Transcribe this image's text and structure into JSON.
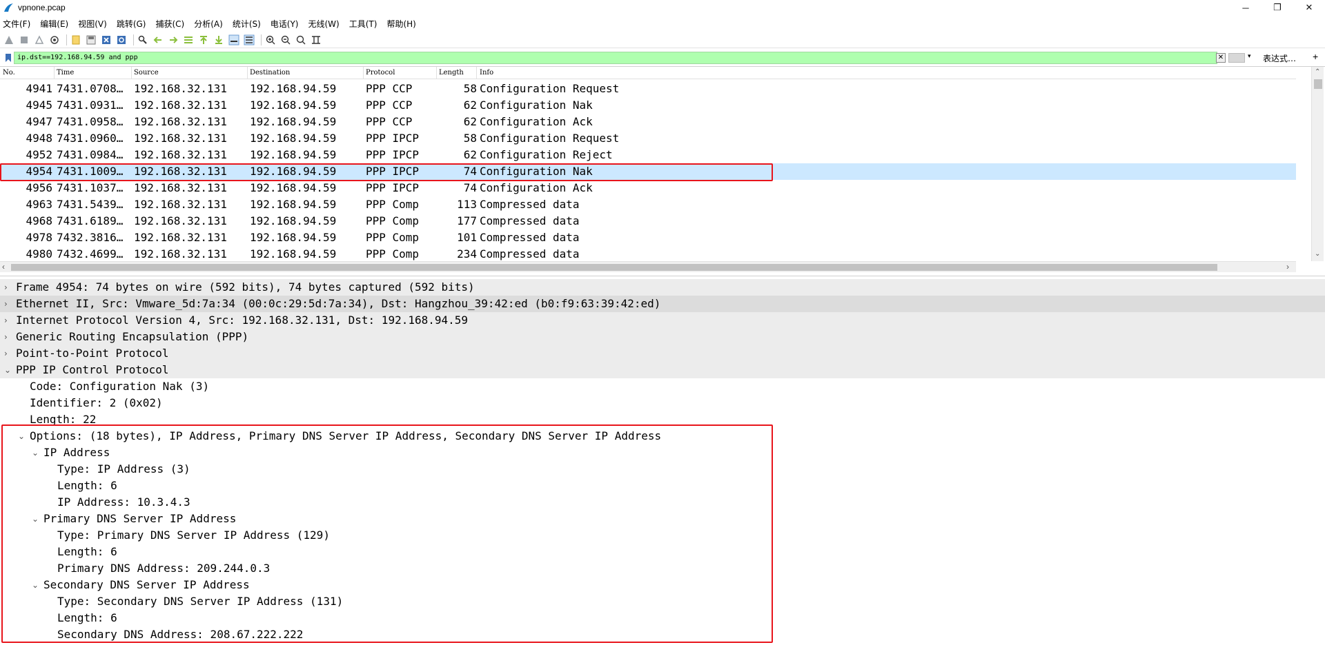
{
  "window": {
    "title": "vpnone.pcap",
    "minimize": "─",
    "restore": "❐",
    "close": "✕"
  },
  "menu": [
    "文件(F)",
    "编辑(E)",
    "视图(V)",
    "跳转(G)",
    "捕获(C)",
    "分析(A)",
    "统计(S)",
    "电话(Y)",
    "无线(W)",
    "工具(T)",
    "帮助(H)"
  ],
  "filter": {
    "value": "ip.dst==192.168.94.59 and ppp",
    "clear": "✕",
    "dropdown": "▾",
    "expression_label": "表达式…",
    "plus": "+"
  },
  "packet_list": {
    "columns": [
      "No.",
      "Time",
      "Source",
      "Destination",
      "Protocol",
      "Length",
      "Info"
    ],
    "rows": [
      {
        "no": "4941",
        "time": "7431.0708…",
        "src": "192.168.32.131",
        "dst": "192.168.94.59",
        "proto": "PPP CCP",
        "len": "58",
        "info": "Configuration Request"
      },
      {
        "no": "4945",
        "time": "7431.0931…",
        "src": "192.168.32.131",
        "dst": "192.168.94.59",
        "proto": "PPP CCP",
        "len": "62",
        "info": "Configuration Nak"
      },
      {
        "no": "4947",
        "time": "7431.0958…",
        "src": "192.168.32.131",
        "dst": "192.168.94.59",
        "proto": "PPP CCP",
        "len": "62",
        "info": "Configuration Ack"
      },
      {
        "no": "4948",
        "time": "7431.0960…",
        "src": "192.168.32.131",
        "dst": "192.168.94.59",
        "proto": "PPP IPCP",
        "len": "58",
        "info": "Configuration Request"
      },
      {
        "no": "4952",
        "time": "7431.0984…",
        "src": "192.168.32.131",
        "dst": "192.168.94.59",
        "proto": "PPP IPCP",
        "len": "62",
        "info": "Configuration Reject"
      },
      {
        "no": "4954",
        "time": "7431.1009…",
        "src": "192.168.32.131",
        "dst": "192.168.94.59",
        "proto": "PPP IPCP",
        "len": "74",
        "info": "Configuration Nak",
        "selected": true
      },
      {
        "no": "4956",
        "time": "7431.1037…",
        "src": "192.168.32.131",
        "dst": "192.168.94.59",
        "proto": "PPP IPCP",
        "len": "74",
        "info": "Configuration Ack"
      },
      {
        "no": "4963",
        "time": "7431.5439…",
        "src": "192.168.32.131",
        "dst": "192.168.94.59",
        "proto": "PPP Comp",
        "len": "113",
        "info": "Compressed data"
      },
      {
        "no": "4968",
        "time": "7431.6189…",
        "src": "192.168.32.131",
        "dst": "192.168.94.59",
        "proto": "PPP Comp",
        "len": "177",
        "info": "Compressed data"
      },
      {
        "no": "4978",
        "time": "7432.3816…",
        "src": "192.168.32.131",
        "dst": "192.168.94.59",
        "proto": "PPP Comp",
        "len": "101",
        "info": "Compressed data"
      },
      {
        "no": "4980",
        "time": "7432.4699…",
        "src": "192.168.32.131",
        "dst": "192.168.94.59",
        "proto": "PPP Comp",
        "len": "234",
        "info": "Compressed data"
      }
    ]
  },
  "details": [
    {
      "text": "Frame 4954: 74 bytes on wire (592 bits), 74 bytes captured (592 bits)",
      "arrow": "›"
    },
    {
      "text": "Ethernet II, Src: Vmware_5d:7a:34 (00:0c:29:5d:7a:34), Dst: Hangzhou_39:42:ed (b0:f9:63:39:42:ed)",
      "arrow": "›"
    },
    {
      "text": "Internet Protocol Version 4, Src: 192.168.32.131, Dst: 192.168.94.59",
      "arrow": "›"
    },
    {
      "text": "Generic Routing Encapsulation (PPP)",
      "arrow": "›"
    },
    {
      "text": "Point-to-Point Protocol",
      "arrow": "›"
    },
    {
      "text": "PPP IP Control Protocol",
      "arrow": "⌄"
    },
    {
      "text": "Code: Configuration Nak (3)",
      "arrow": ""
    },
    {
      "text": "Identifier: 2 (0x02)",
      "arrow": ""
    },
    {
      "text": "Length: 22",
      "arrow": ""
    },
    {
      "text": "Options: (18 bytes), IP Address, Primary DNS Server IP Address, Secondary DNS Server IP Address",
      "arrow": "⌄"
    },
    {
      "text": "IP Address",
      "arrow": "⌄"
    },
    {
      "text": "Type: IP Address (3)",
      "arrow": ""
    },
    {
      "text": "Length: 6",
      "arrow": ""
    },
    {
      "text": "IP Address: 10.3.4.3",
      "arrow": ""
    },
    {
      "text": "Primary DNS Server IP Address",
      "arrow": "⌄"
    },
    {
      "text": "Type: Primary DNS Server IP Address (129)",
      "arrow": ""
    },
    {
      "text": "Length: 6",
      "arrow": ""
    },
    {
      "text": "Primary DNS Address: 209.244.0.3",
      "arrow": ""
    },
    {
      "text": "Secondary DNS Server IP Address",
      "arrow": "⌄"
    },
    {
      "text": "Type: Secondary DNS Server IP Address (131)",
      "arrow": ""
    },
    {
      "text": "Length: 6",
      "arrow": ""
    },
    {
      "text": "Secondary DNS Address: 208.67.222.222",
      "arrow": ""
    }
  ],
  "colors": {
    "filter_bg": "#afffaf",
    "selected_row": "#cce8ff",
    "highlight_box": "#e8141b"
  }
}
